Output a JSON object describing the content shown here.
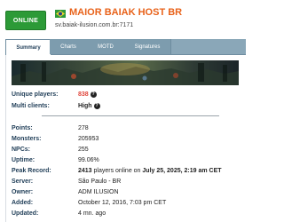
{
  "status_badge": "ONLINE",
  "server": {
    "name": "MAIOR BAIAK HOST BR",
    "host": "sv.baiak-ilusion.com.br:7171",
    "flag": "brazil-flag-icon"
  },
  "tabs": [
    {
      "label": "Summary",
      "active": true
    },
    {
      "label": "Charts",
      "active": false
    },
    {
      "label": "MOTD",
      "active": false
    },
    {
      "label": "Signatures",
      "active": false
    }
  ],
  "stats_top": {
    "unique_players_label": "Unique players:",
    "unique_players_value": "838",
    "multi_clients_label": "Multi clients:",
    "multi_clients_value": "High"
  },
  "stats": {
    "points_label": "Points:",
    "points_value": "278",
    "monsters_label": "Monsters:",
    "monsters_value": "205953",
    "npcs_label": "NPCs:",
    "npcs_value": "255",
    "uptime_label": "Uptime:",
    "uptime_value": "99.06%",
    "peak_label": "Peak Record:",
    "peak_number": "2413",
    "peak_mid": " players online on ",
    "peak_date": "July 25, 2025, 2:19 am CET",
    "server_label": "Server:",
    "server_value": "São Paulo - BR",
    "owner_label": "Owner:",
    "owner_value": "ADM ILUSION",
    "added_label": "Added:",
    "added_value": "October 12, 2016, 7:03 pm CET",
    "updated_label": "Updated:",
    "updated_value": "4 mn. ago"
  },
  "help_glyph": "?",
  "colors": {
    "online_green": "#2c9a37",
    "server_name_orange": "#e8621a",
    "label_blue": "#1f3d57",
    "unique_players_red": "#e0443a",
    "tab_bar": "#8aa7b8"
  }
}
